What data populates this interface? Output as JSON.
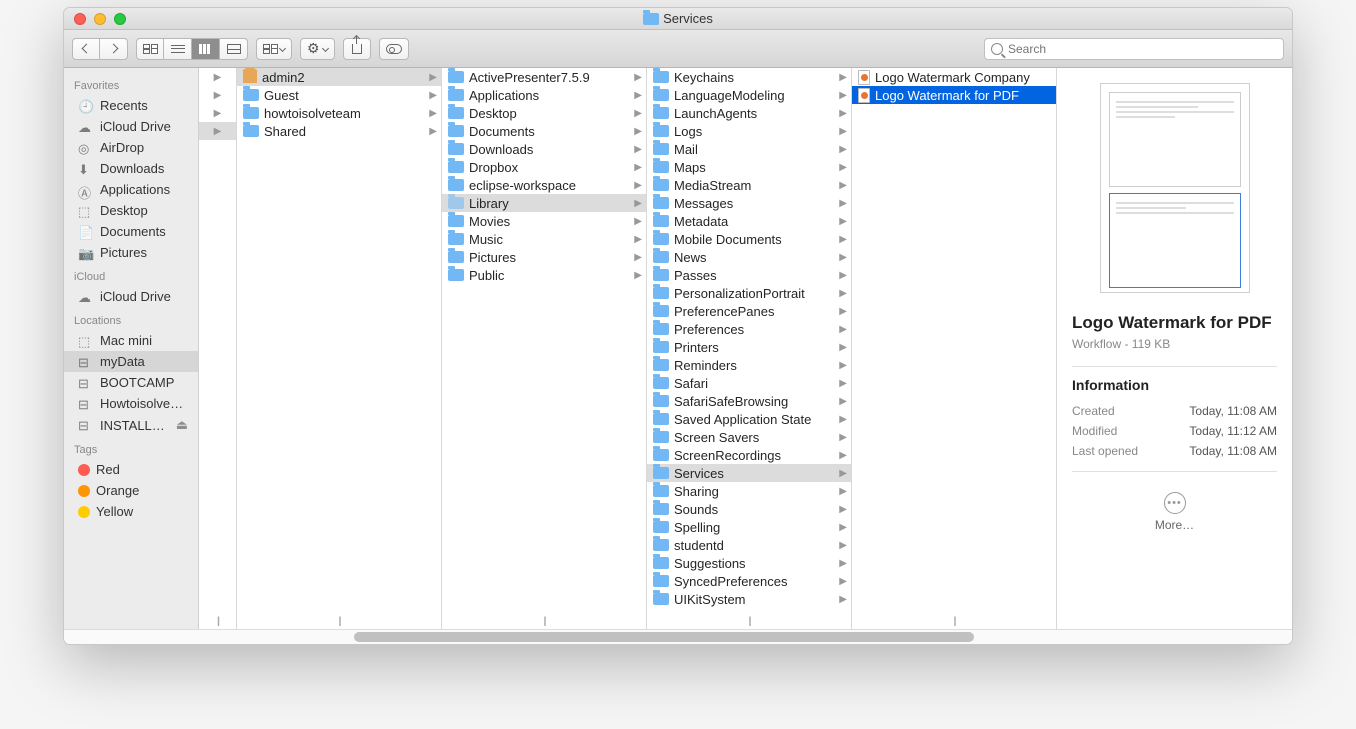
{
  "window_title": "Services",
  "search_placeholder": "Search",
  "sidebar": {
    "sections": [
      {
        "heading": "Favorites",
        "items": [
          {
            "label": "Recents",
            "icon": "clock"
          },
          {
            "label": "iCloud Drive",
            "icon": "cloud"
          },
          {
            "label": "AirDrop",
            "icon": "airdrop"
          },
          {
            "label": "Downloads",
            "icon": "download"
          },
          {
            "label": "Applications",
            "icon": "apps"
          },
          {
            "label": "Desktop",
            "icon": "desktop"
          },
          {
            "label": "Documents",
            "icon": "docs"
          },
          {
            "label": "Pictures",
            "icon": "pics"
          }
        ]
      },
      {
        "heading": "iCloud",
        "items": [
          {
            "label": "iCloud Drive",
            "icon": "cloud"
          }
        ]
      },
      {
        "heading": "Locations",
        "items": [
          {
            "label": "Mac mini",
            "icon": "mac"
          },
          {
            "label": "myData",
            "icon": "disk",
            "selected": true
          },
          {
            "label": "BOOTCAMP",
            "icon": "disk"
          },
          {
            "label": "Howtoisolve…",
            "icon": "disk"
          },
          {
            "label": "INSTALL…",
            "icon": "disk",
            "eject": true
          }
        ]
      },
      {
        "heading": "Tags",
        "items": [
          {
            "label": "Red",
            "color": "#ff5b52"
          },
          {
            "label": "Orange",
            "color": "#ff9500"
          },
          {
            "label": "Yellow",
            "color": "#ffcc00"
          }
        ]
      }
    ]
  },
  "col0": [
    {
      "arrow": true
    },
    {
      "arrow": true
    },
    {
      "arrow": true
    },
    {
      "arrow": true,
      "selected": true
    }
  ],
  "col1": [
    {
      "label": "admin2",
      "icon": "home",
      "arrow": true,
      "selected": true
    },
    {
      "label": "Guest",
      "icon": "folder",
      "arrow": true
    },
    {
      "label": "howtoisolveteam",
      "icon": "folder",
      "arrow": true
    },
    {
      "label": "Shared",
      "icon": "folder",
      "arrow": true
    }
  ],
  "col2": [
    {
      "label": "ActivePresenter7.5.9",
      "icon": "folder",
      "arrow": true
    },
    {
      "label": "Applications",
      "icon": "folder",
      "arrow": true
    },
    {
      "label": "Desktop",
      "icon": "folder",
      "arrow": true
    },
    {
      "label": "Documents",
      "icon": "folder",
      "arrow": true
    },
    {
      "label": "Downloads",
      "icon": "folder",
      "arrow": true
    },
    {
      "label": "Dropbox",
      "icon": "folder",
      "arrow": true
    },
    {
      "label": "eclipse-workspace",
      "icon": "folder",
      "arrow": true
    },
    {
      "label": "Library",
      "icon": "folder-dim",
      "arrow": true,
      "selected": true
    },
    {
      "label": "Movies",
      "icon": "folder",
      "arrow": true
    },
    {
      "label": "Music",
      "icon": "folder",
      "arrow": true
    },
    {
      "label": "Pictures",
      "icon": "folder",
      "arrow": true
    },
    {
      "label": "Public",
      "icon": "folder",
      "arrow": true
    }
  ],
  "col3": [
    {
      "label": "Keychains",
      "arrow": true
    },
    {
      "label": "LanguageModeling",
      "arrow": true
    },
    {
      "label": "LaunchAgents",
      "arrow": true
    },
    {
      "label": "Logs",
      "arrow": true
    },
    {
      "label": "Mail",
      "arrow": true
    },
    {
      "label": "Maps",
      "arrow": true
    },
    {
      "label": "MediaStream",
      "arrow": true
    },
    {
      "label": "Messages",
      "arrow": true
    },
    {
      "label": "Metadata",
      "arrow": true
    },
    {
      "label": "Mobile Documents",
      "arrow": true
    },
    {
      "label": "News",
      "arrow": true
    },
    {
      "label": "Passes",
      "arrow": true
    },
    {
      "label": "PersonalizationPortrait",
      "arrow": true
    },
    {
      "label": "PreferencePanes",
      "arrow": true
    },
    {
      "label": "Preferences",
      "arrow": true
    },
    {
      "label": "Printers",
      "arrow": true
    },
    {
      "label": "Reminders",
      "arrow": true
    },
    {
      "label": "Safari",
      "arrow": true
    },
    {
      "label": "SafariSafeBrowsing",
      "arrow": true
    },
    {
      "label": "Saved Application State",
      "arrow": true
    },
    {
      "label": "Screen Savers",
      "arrow": true
    },
    {
      "label": "ScreenRecordings",
      "arrow": true
    },
    {
      "label": "Services",
      "arrow": true,
      "selected": true
    },
    {
      "label": "Sharing",
      "arrow": true
    },
    {
      "label": "Sounds",
      "arrow": true
    },
    {
      "label": "Spelling",
      "arrow": true
    },
    {
      "label": "studentd",
      "arrow": true
    },
    {
      "label": "Suggestions",
      "arrow": true
    },
    {
      "label": "SyncedPreferences",
      "arrow": true
    },
    {
      "label": "UIKitSystem",
      "arrow": true
    }
  ],
  "col4": [
    {
      "label": "Logo Watermark Company",
      "icon": "doc"
    },
    {
      "label": "Logo Watermark for PDF",
      "icon": "doc",
      "selected_blue": true
    }
  ],
  "preview": {
    "title": "Logo Watermark for PDF",
    "subtitle": "Workflow - 119 KB",
    "info_heading": "Information",
    "rows": [
      {
        "k": "Created",
        "v": "Today, 11:08 AM"
      },
      {
        "k": "Modified",
        "v": "Today, 11:12 AM"
      },
      {
        "k": "Last opened",
        "v": "Today, 11:08 AM"
      }
    ],
    "more": "More…"
  }
}
